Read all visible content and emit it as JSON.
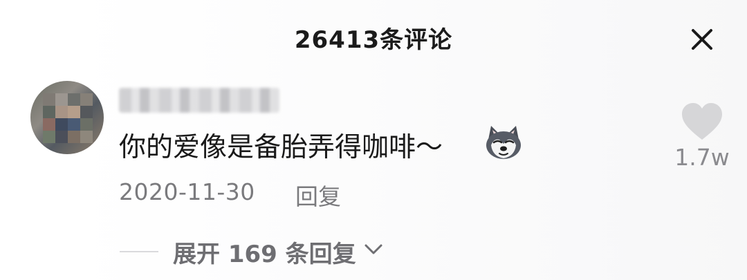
{
  "header": {
    "title": "26413条评论",
    "close_icon": "close-icon"
  },
  "comment": {
    "avatar_icon": "avatar",
    "username_blurred": "",
    "text": "你的爱像是备胎弄得咖啡～",
    "emoji_icon": "husky-dog-emoji-icon",
    "date": "2020-11-30",
    "reply_label": "回复",
    "likes": {
      "count_label": "1.7w",
      "icon": "heart-icon",
      "color": "#d6d6d8"
    }
  },
  "replies": {
    "expand_label": "展开 169 条回复",
    "chevron_icon": "chevron-down-icon"
  }
}
